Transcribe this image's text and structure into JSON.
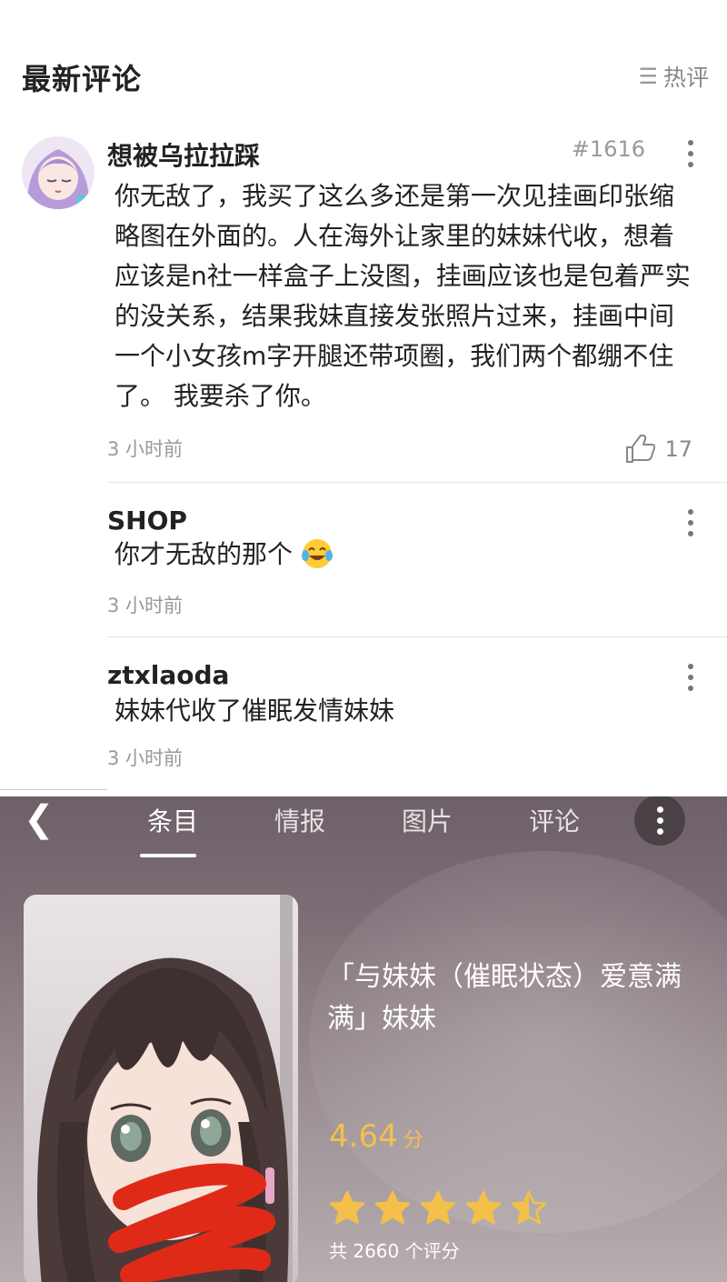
{
  "comments_section": {
    "title": "最新评论",
    "sort_label": "热评",
    "sort_icon": "menu-icon"
  },
  "comments": [
    {
      "user": "想被乌拉拉踩",
      "floor": "#1616",
      "text": "你无敌了，我买了这么多还是第一次见挂画印张缩略图在外面的。人在海外让家里的妹妹代收，想着应该是n社一样盒子上没图，挂画应该也是包着严实的没关系，结果我妹直接发张照片过来，挂画中间一个小女孩m字开腿还带项圈，我们两个都绷不住了。 我要杀了你。",
      "time": "3 小时前",
      "likes": "17"
    },
    {
      "user": "SHOP",
      "text": "你才无敌的那个",
      "emoji": "tears-of-joy-emoji",
      "time": "3 小时前"
    },
    {
      "user": "ztxlaoda",
      "text": "妹妹代收了催眠发情妹妹",
      "time": "3 小时前"
    }
  ],
  "product": {
    "tabs": [
      {
        "label": "条目"
      },
      {
        "label": "情报"
      },
      {
        "label": "图片"
      },
      {
        "label": "评论"
      }
    ],
    "active_tab": 0,
    "title": "「与妹妹（催眠状态）爱意满满」妹妹",
    "score": "4.64",
    "score_unit": "分",
    "stars_value": 4.5,
    "stars_max": 5,
    "rating_count": "共 2660 个评分",
    "accent_color": "#f4c04a"
  }
}
